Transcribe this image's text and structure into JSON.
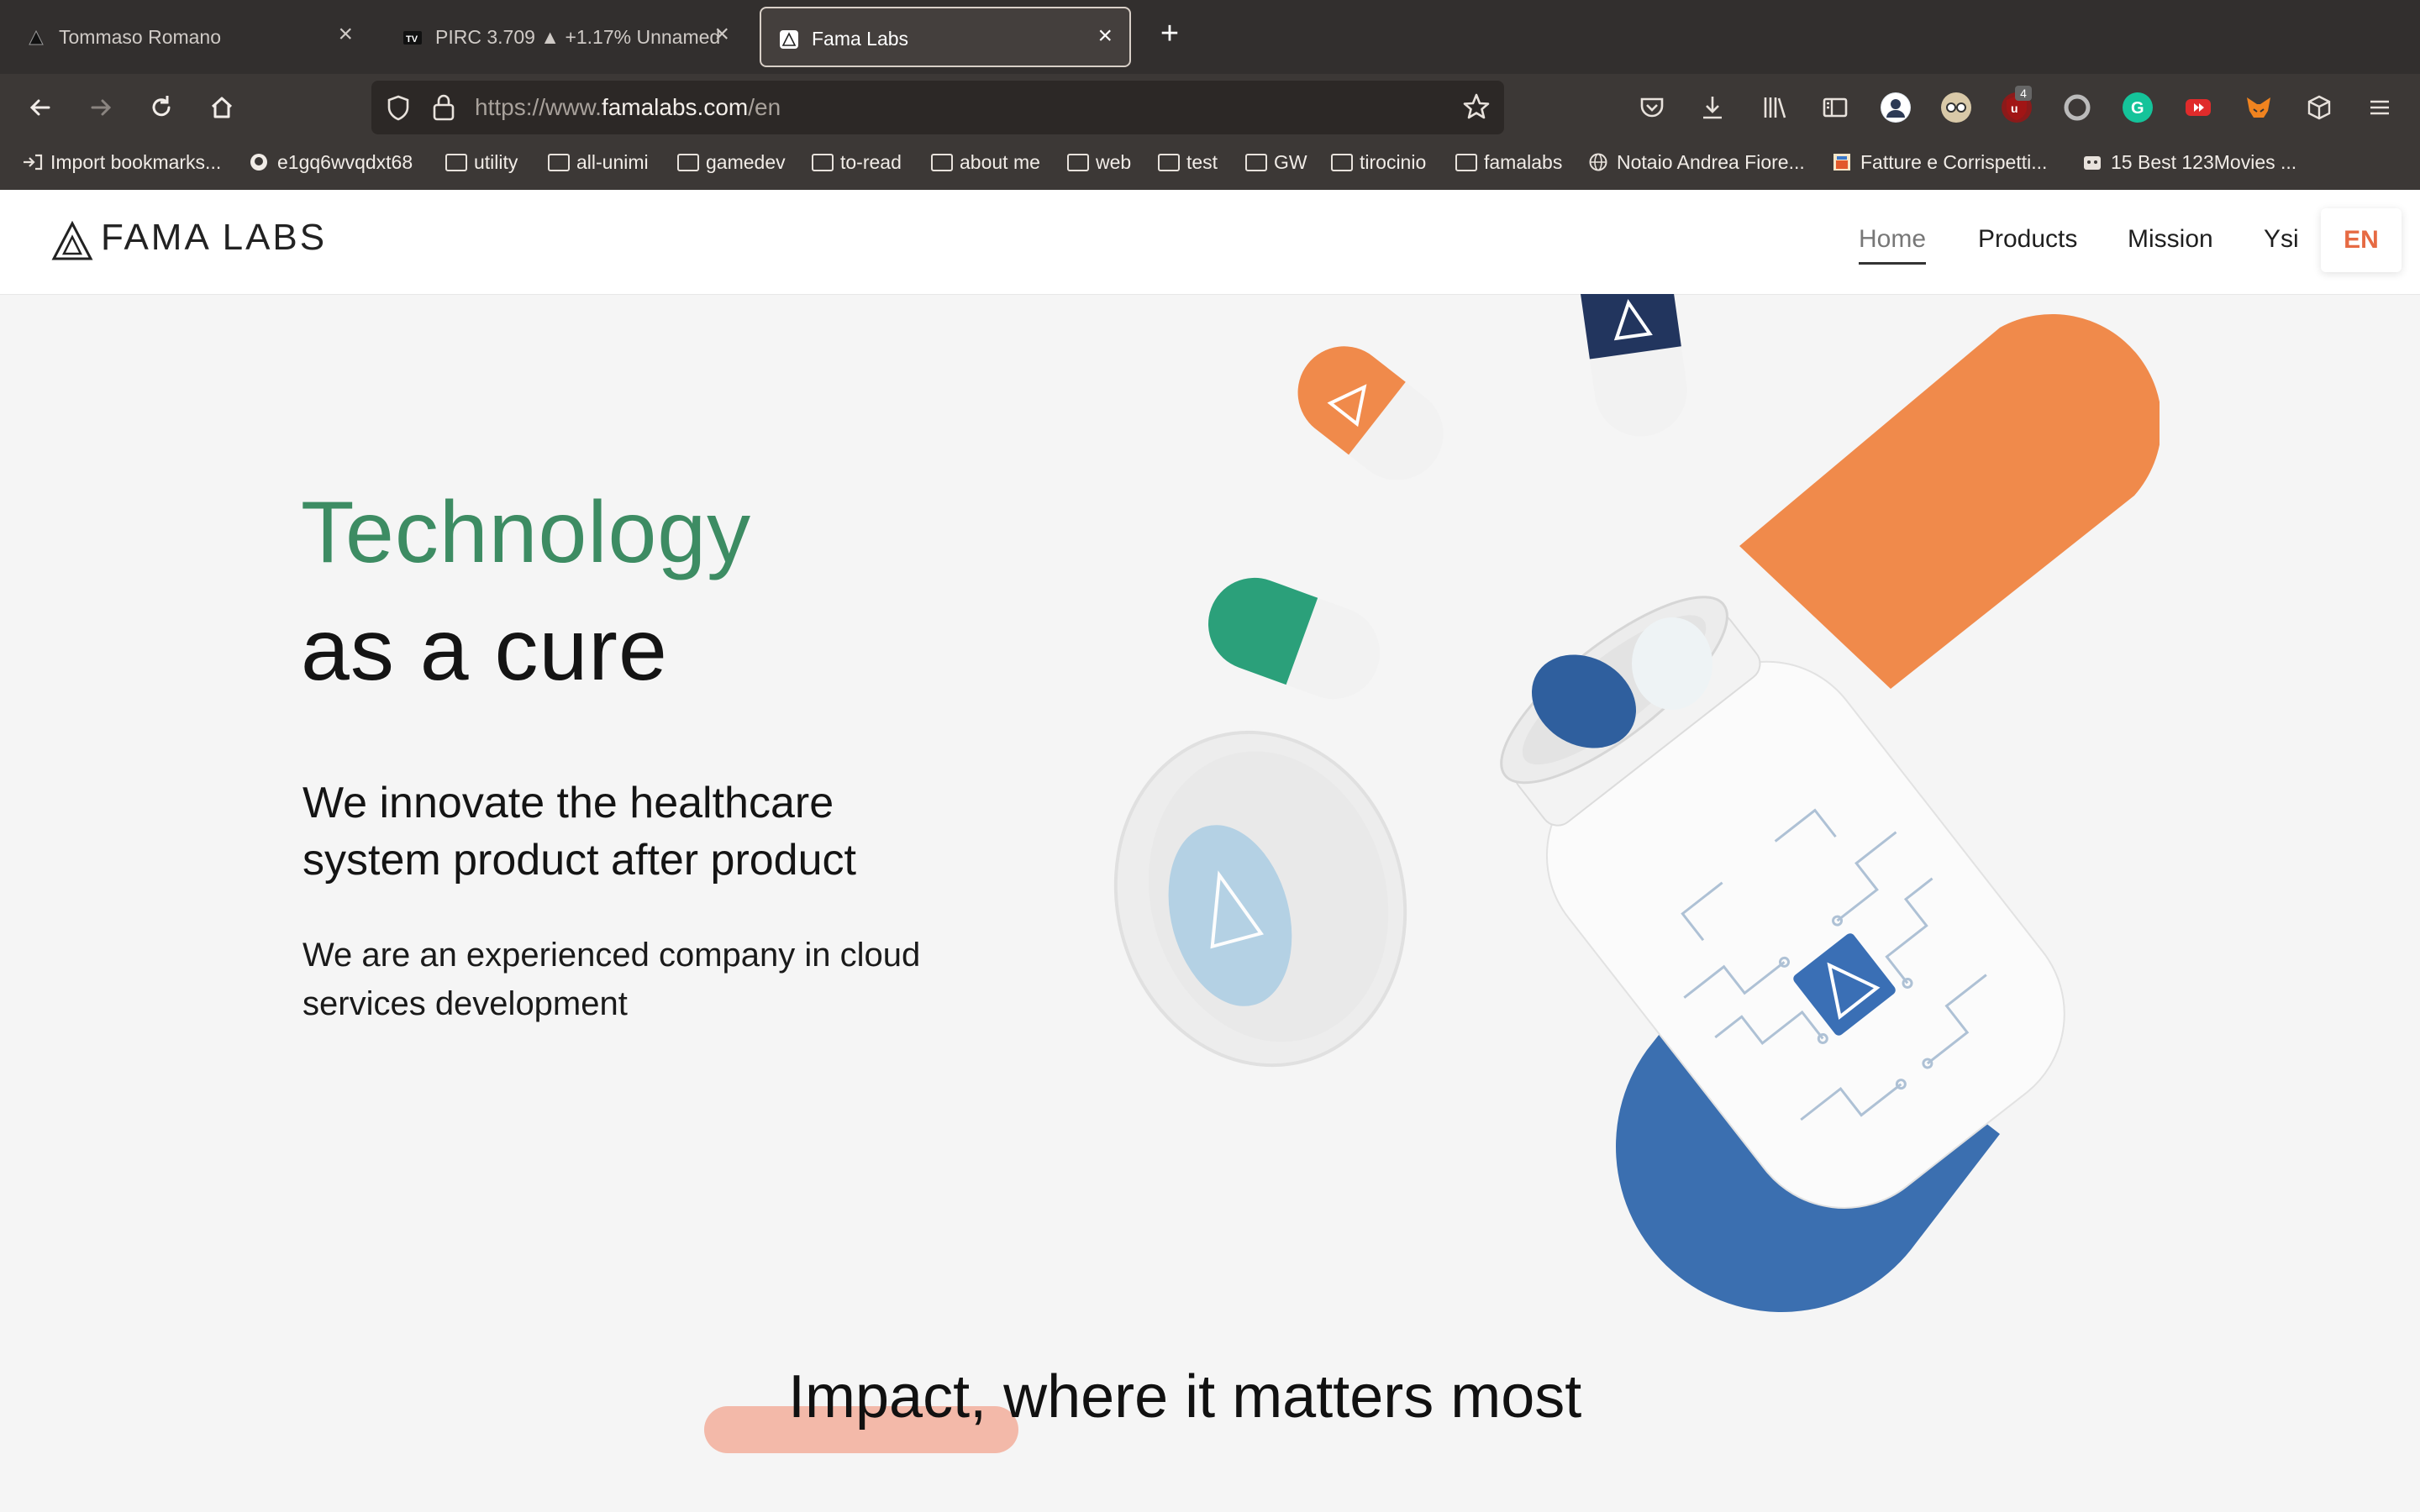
{
  "browser": {
    "tabs": [
      {
        "title": "Tommaso Romano",
        "active": false
      },
      {
        "title": "PIRC 3.709 ▲ +1.17% Unnamed",
        "active": false
      },
      {
        "title": "Fama Labs",
        "active": true
      }
    ],
    "new_tab_icon": "plus-icon",
    "url_prefix": "https://www.",
    "url_domain": "famalabs.com",
    "url_path": "/en",
    "toolbar_badge": "4",
    "bookmarks": [
      {
        "label": "Import bookmarks...",
        "icon": "import-icon"
      },
      {
        "label": "e1gq6wvqdxt68",
        "icon": "github-icon"
      },
      {
        "label": "utility",
        "icon": "folder-icon"
      },
      {
        "label": "all-unimi",
        "icon": "folder-icon"
      },
      {
        "label": "gamedev",
        "icon": "folder-icon"
      },
      {
        "label": "to-read",
        "icon": "folder-icon"
      },
      {
        "label": "about me",
        "icon": "folder-icon"
      },
      {
        "label": "web",
        "icon": "folder-icon"
      },
      {
        "label": "test",
        "icon": "folder-icon"
      },
      {
        "label": "GW",
        "icon": "folder-icon"
      },
      {
        "label": "tirocinio",
        "icon": "folder-icon"
      },
      {
        "label": "famalabs",
        "icon": "folder-icon"
      },
      {
        "label": "Notaio Andrea Fiore...",
        "icon": "globe-icon"
      },
      {
        "label": "Fatture e Corrispetti...",
        "icon": "site-icon"
      },
      {
        "label": "15 Best 123Movies ...",
        "icon": "site-icon"
      }
    ]
  },
  "site": {
    "logo": "FAMA LABS",
    "nav": {
      "home": "Home",
      "products": "Products",
      "mission": "Mission",
      "ysi": "Ysi",
      "lang": "EN"
    },
    "hero": {
      "line1": "Technology",
      "line2": "as a cure",
      "subtitle": "We innovate the healthcare system product after product",
      "description": "We are an experienced company in cloud services development"
    },
    "impact_title": "Impact, where it matters most",
    "colors": {
      "accent_green": "#3d8c63",
      "accent_orange": "#e66a43",
      "pill_orange": "#f08a4b",
      "pill_blue": "#3b6fb0",
      "pill_teal": "#2ba07a"
    }
  }
}
